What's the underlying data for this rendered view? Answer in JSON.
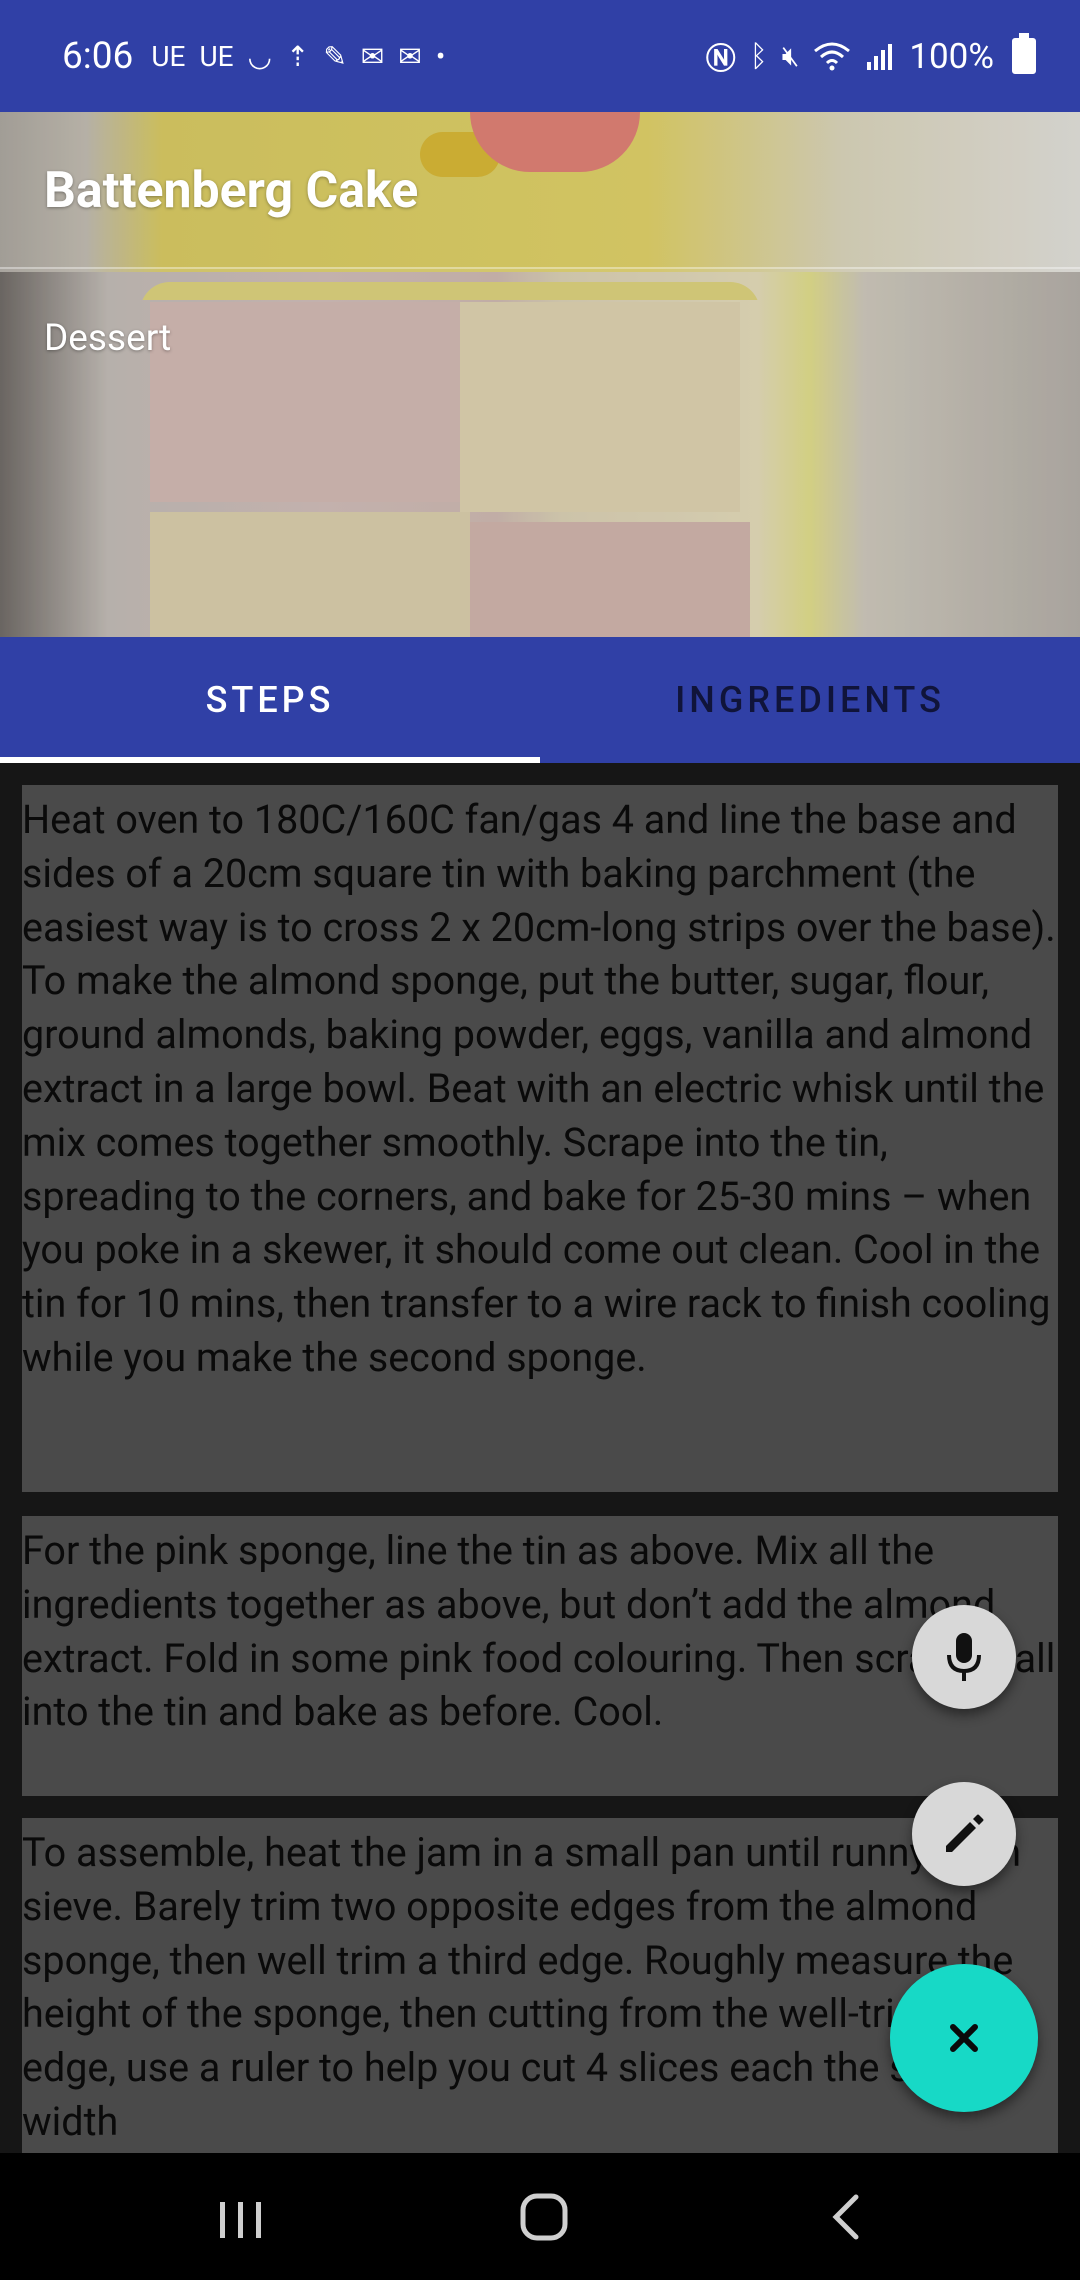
{
  "status_bar": {
    "time": "6:06",
    "left_icons": [
      "UE",
      "UE"
    ],
    "battery_text": "100%"
  },
  "recipe": {
    "title": "Battenberg Cake",
    "category": "Dessert"
  },
  "tabs": [
    {
      "label": "STEPS",
      "active": true
    },
    {
      "label": "INGREDIENTS",
      "active": false
    }
  ],
  "steps": [
    "Heat oven to 180C/160C fan/gas 4 and line the base and sides of a 20cm square tin with baking parchment (the easiest way is to cross 2 x 20cm-long strips over the base). To make the almond sponge, put the butter, sugar, flour, ground almonds, baking powder, eggs, vanilla and almond extract in a large bowl. Beat with an electric whisk until the mix comes together smoothly. Scrape into the tin, spreading to the corners, and bake for 25-30 mins – when you poke in a skewer, it should come out clean. Cool in the tin for 10 mins, then transfer to a wire rack to finish cooling while you make the second sponge.",
    "For the pink sponge, line the tin as above. Mix all the ingredients together as above, but don’t add the almond extract. Fold in some pink food colouring. Then scrape it all into the tin and bake as before. Cool.",
    "To assemble, heat the jam in a small pan until runny, then sieve. Barely trim two opposite edges from the almond sponge, then well trim a third edge. Roughly measure the height of the sponge, then cutting from the well-trimmed edge, use a ruler to help you cut 4 slices each the same width"
  ],
  "fabs": {
    "mic_icon": "microphone-icon",
    "edit_icon": "pencil-icon",
    "close_icon": "close-icon"
  },
  "colors": {
    "primary": "#3040A6",
    "accent": "#17D9C6",
    "step_card": "#4A4A4A",
    "background": "#161616"
  }
}
